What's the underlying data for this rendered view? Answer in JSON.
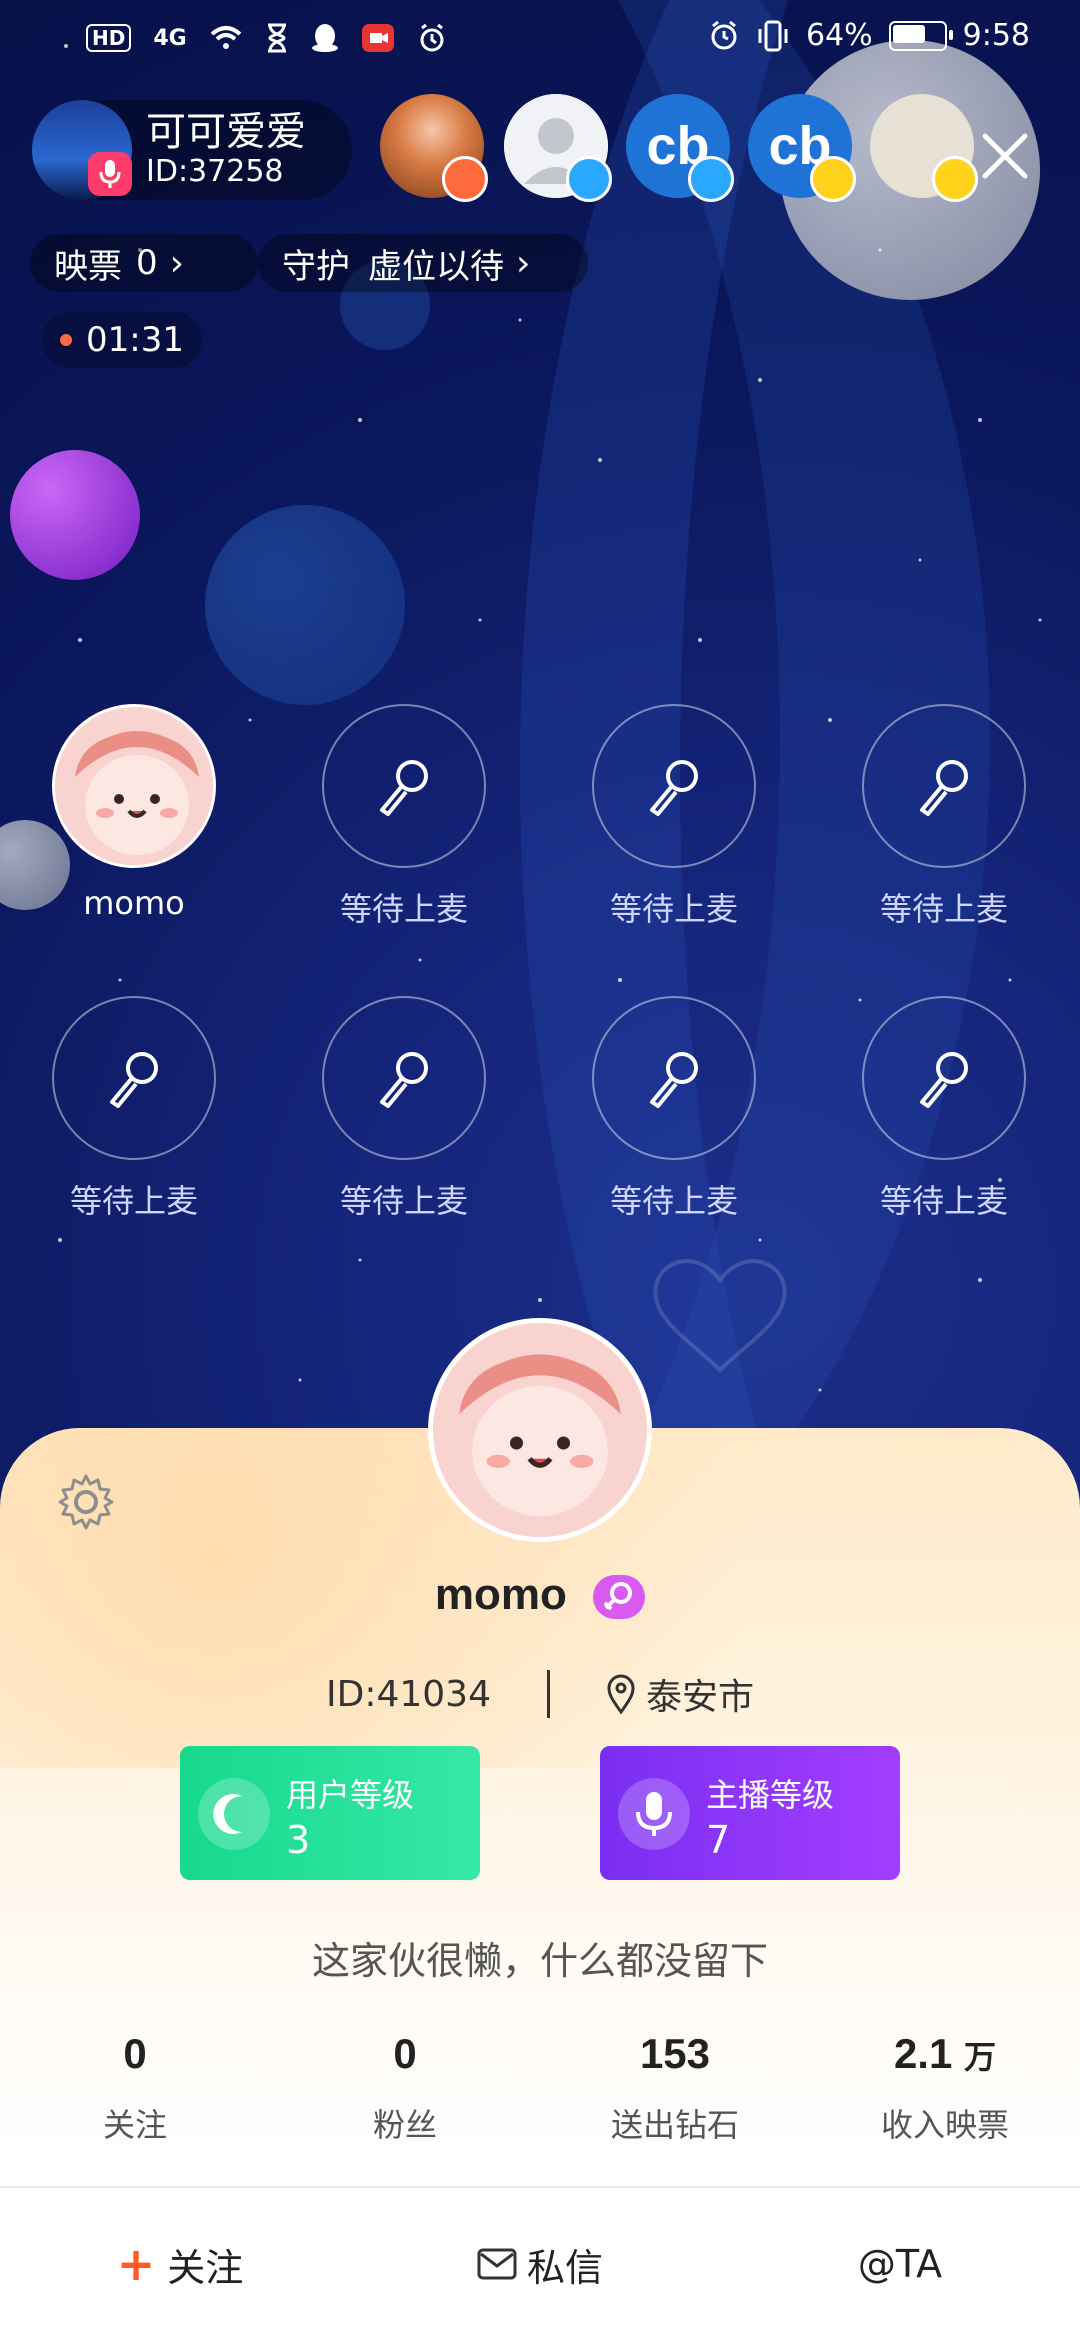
{
  "status_bar": {
    "left_icons": [
      "HD",
      "4G",
      "wifi-icon",
      "hourglass-icon",
      "qq-icon",
      "video-icon",
      "timer-icon"
    ],
    "battery": "64%",
    "battery_level": 0.64,
    "time": "9:58"
  },
  "host": {
    "name": "可可爱爱",
    "id": "ID:37258"
  },
  "audience": [
    {
      "kind": "avatar",
      "badge_color": "#ff6a3d"
    },
    {
      "kind": "avatar",
      "badge_color": "#2aa8ff"
    },
    {
      "kind": "logo",
      "logo_text": "cb",
      "badge_color": "#2aa8ff"
    },
    {
      "kind": "logo",
      "logo_text": "cb",
      "badge_color": "#ffd21c"
    },
    {
      "kind": "avatar",
      "badge_color": "#ffd21c"
    }
  ],
  "chips": {
    "votes": {
      "label": "映票",
      "value": "0"
    },
    "guard": {
      "label": "守护",
      "value": "虚位以待"
    }
  },
  "timer": "01:31",
  "seats": [
    {
      "label": "momo",
      "occupied": true
    },
    {
      "label": "等待上麦"
    },
    {
      "label": "等待上麦"
    },
    {
      "label": "等待上麦"
    },
    {
      "label": "等待上麦"
    },
    {
      "label": "等待上麦"
    },
    {
      "label": "等待上麦"
    },
    {
      "label": "等待上麦"
    }
  ],
  "profile": {
    "name": "momo",
    "id": "ID:41034",
    "location": "泰安市",
    "user_level": {
      "label": "用户等级",
      "value": "3"
    },
    "host_level": {
      "label": "主播等级",
      "value": "7"
    },
    "signature": "这家伙很懒，什么都没留下",
    "stats": [
      {
        "num": "0",
        "unit": "",
        "label": "关注"
      },
      {
        "num": "0",
        "unit": "",
        "label": "粉丝"
      },
      {
        "num": "153",
        "unit": "",
        "label": "送出钻石"
      },
      {
        "num": "2.1",
        "unit": "万",
        "label": "收入映票"
      }
    ],
    "actions": {
      "follow": "关注",
      "message": "私信",
      "mention": "@TA"
    }
  },
  "colors": {
    "user_level": "#1fdc96",
    "host_level": "#8a35f7",
    "follow_plus": "#ff5a2a"
  }
}
